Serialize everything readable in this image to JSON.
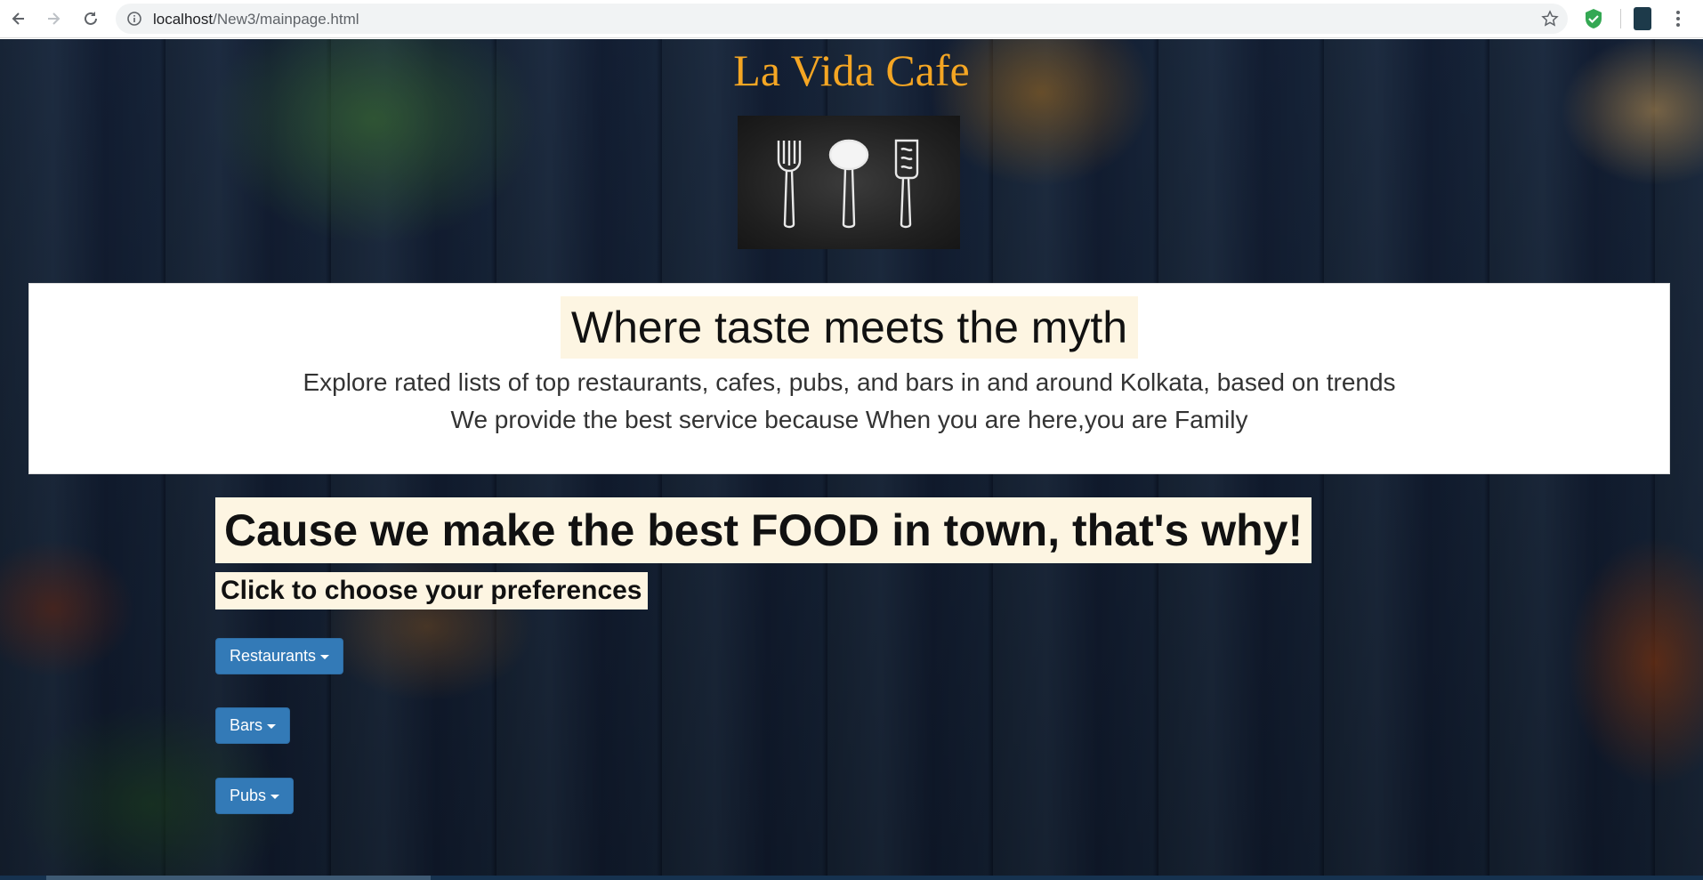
{
  "browser": {
    "url_host": "localhost",
    "url_path": "/New3/mainpage.html"
  },
  "site": {
    "title": "La Vida Cafe",
    "logo_icons": [
      "fork-icon",
      "spoon-icon",
      "spatula-icon"
    ]
  },
  "jumbotron": {
    "tagline": "Where taste meets the myth",
    "line1": "Explore rated lists of top restaurants, cafes, pubs, and bars in and around Kolkata, based on trends",
    "line2": "We provide the best service because When you are here,you are Family"
  },
  "main": {
    "headline": "Cause we make the best FOOD in town, that's why!",
    "prompt": "Click to choose your preferences",
    "dropdowns": [
      {
        "label": "Restaurants"
      },
      {
        "label": "Bars"
      },
      {
        "label": "Pubs"
      }
    ]
  },
  "colors": {
    "title": "#f5a623",
    "highlight_bg": "#fdf5e2",
    "button_bg": "#337ab7"
  }
}
